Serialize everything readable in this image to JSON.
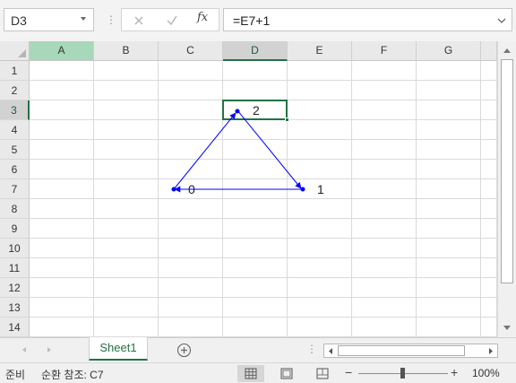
{
  "formula_bar": {
    "name_box": "D3",
    "formula": "=E7+1",
    "fx_label": "fx"
  },
  "columns": [
    "A",
    "B",
    "C",
    "D",
    "E",
    "F",
    "G"
  ],
  "rows": [
    "1",
    "2",
    "3",
    "4",
    "5",
    "6",
    "7",
    "8",
    "9",
    "10",
    "11",
    "12",
    "13",
    "14"
  ],
  "selected_cell": "D3",
  "cells": {
    "D3": "2",
    "C7": "0",
    "E7": "1"
  },
  "sheet_tabs": {
    "active": "Sheet1",
    "ellipsis": "⋮"
  },
  "status_bar": {
    "ready": "준비",
    "circular_ref": "순환 참조: C7",
    "zoom_minus": "−",
    "zoom_plus": "+",
    "zoom": "100%"
  },
  "colors": {
    "accent": "#217346",
    "arrow": "#0000ff",
    "header_bg": "#e9e9e9",
    "gridline": "#dadada"
  },
  "icons": {
    "name_box_dropdown": "chevron-down-icon",
    "cancel": "x-icon",
    "enter": "check-icon",
    "insert_function": "fx-icon",
    "add_sheet": "plus-circle-icon"
  }
}
